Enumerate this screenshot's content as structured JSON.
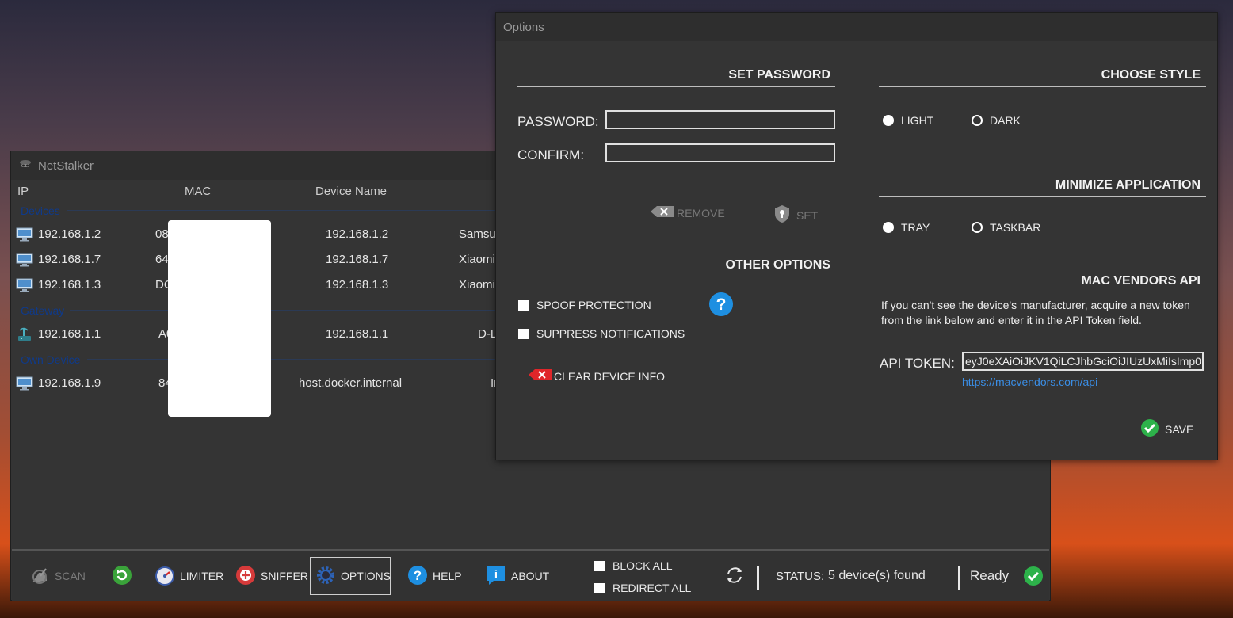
{
  "main_window": {
    "title": "NetStalker",
    "columns": [
      "IP",
      "MAC",
      "Device Name"
    ],
    "groups": {
      "devices": "Devices",
      "gateway": "Gateway",
      "own_device": "Own Device"
    },
    "rows": [
      {
        "ip": "192.168.1.2",
        "mac": "08",
        "device_name": "192.168.1.2",
        "vendor": "Samsu",
        "icon": "monitor-icon"
      },
      {
        "ip": "192.168.1.7",
        "mac": "64",
        "device_name": "192.168.1.7",
        "vendor": "Xiaomi",
        "icon": "monitor-icon"
      },
      {
        "ip": "192.168.1.3",
        "mac": "DC",
        "device_name": "192.168.1.3",
        "vendor": "Xiaomi",
        "icon": "monitor-icon"
      },
      {
        "ip": "192.168.1.1",
        "mac": "A0",
        "device_name": "192.168.1.1",
        "vendor": "D-L",
        "icon": "router-icon"
      },
      {
        "ip": "192.168.1.9",
        "mac": "84",
        "device_name": "host.docker.internal",
        "vendor": "In",
        "icon": "monitor-icon"
      }
    ],
    "toolbar": {
      "scan": "SCAN",
      "limiter": "LIMITER",
      "sniffer": "SNIFFER",
      "options": "OPTIONS",
      "help": "HELP",
      "about": "ABOUT",
      "block_all": "BLOCK ALL",
      "redirect_all": "REDIRECT ALL",
      "status_label": "STATUS:",
      "status_value": "5 device(s) found",
      "ready": "Ready"
    }
  },
  "options_window": {
    "title": "Options",
    "set_password": {
      "title": "SET PASSWORD",
      "password_label": "PASSWORD:",
      "confirm_label": "CONFIRM:",
      "remove": "REMOVE",
      "set": "SET"
    },
    "other_options": {
      "title": "OTHER OPTIONS",
      "spoof_protection": "SPOOF PROTECTION",
      "suppress_notifications": "SUPPRESS NOTIFICATIONS",
      "clear_device_info": "CLEAR DEVICE INFO"
    },
    "choose_style": {
      "title": "CHOOSE STYLE",
      "light": "LIGHT",
      "dark": "DARK",
      "selected": "LIGHT"
    },
    "minimize_application": {
      "title": "MINIMIZE APPLICATION",
      "tray": "TRAY",
      "taskbar": "TASKBAR",
      "selected": "TRAY"
    },
    "mac_vendors_api": {
      "title": "MAC VENDORS API",
      "description": "If you can't see the device's manufacturer, acquire a new token from the link below and enter it in the API Token field.",
      "token_label": "API TOKEN:",
      "token_value": "eyJ0eXAiOiJKV1QiLCJhbGciOiJIUzUxMiIsImp0",
      "link": "https://macvendors.com/api"
    },
    "save": "SAVE"
  },
  "colors": {
    "window_bg": "#343434",
    "accent_blue": "#1e8fe1",
    "success_green": "#2db24a",
    "danger_red": "#e0262a",
    "link_blue": "#3a8ee6"
  }
}
